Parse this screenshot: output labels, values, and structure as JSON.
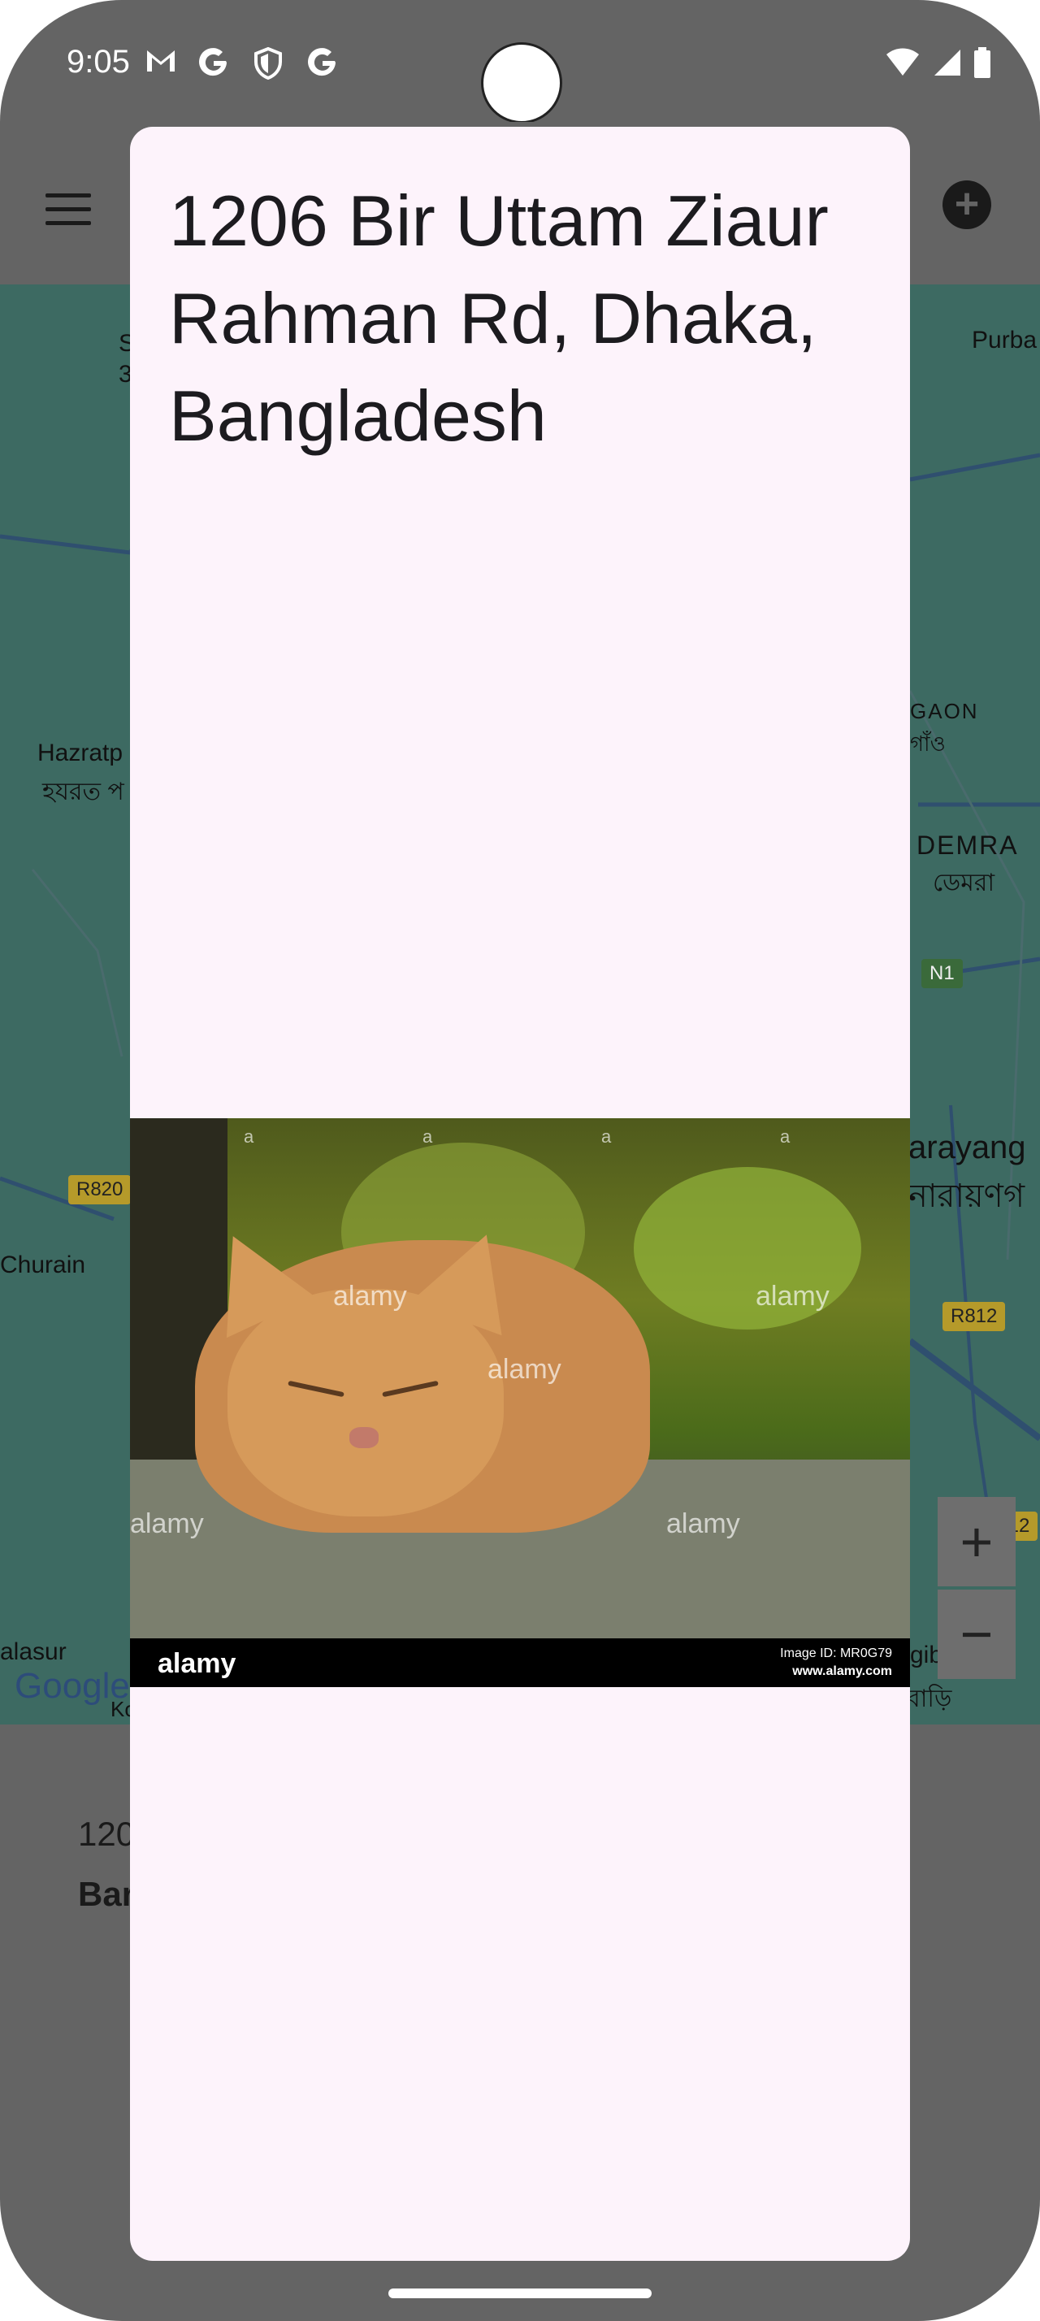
{
  "status_bar": {
    "time": "9:05",
    "left_icons": [
      "gmail-icon",
      "google-icon",
      "shield-icon",
      "google-icon"
    ],
    "right_icons": [
      "wifi-icon",
      "signal-icon",
      "battery-icon"
    ]
  },
  "app_bar": {
    "menu_icon": "menu-icon",
    "action_icon": "add-circle-icon"
  },
  "map": {
    "labels": {
      "purba": "Purba",
      "hazrat_en": "Hazratp",
      "hazrat_bn": "হযরত প",
      "gaon_en": "GAON",
      "gaon_bn": "গাঁও",
      "demra_en": "DEMRA",
      "demra_bn": "ডেমরা",
      "narayang_en": "arayang",
      "narayang_bn": "নারায়ণগ",
      "churain": "Churain",
      "alasur": "alasur",
      "gibari": "gibari",
      "bari_bn": "বাড়ি",
      "edge_s": "S",
      "edge_3": "3",
      "ko": "Ko"
    },
    "road_shields": [
      "R820",
      "N1",
      "R812",
      "R812"
    ],
    "zoom_in": "+",
    "zoom_out": "−",
    "attribution": "Google"
  },
  "background_text": {
    "line1": "120",
    "line2": "Bar"
  },
  "dialog": {
    "title": "1206 Bir Uttam Ziaur Rahman Rd, Dhaka, Bangladesh",
    "image": {
      "footer_logo": "alamy",
      "footer_id": "Image ID: MR0G79",
      "footer_url": "www.alamy.com",
      "watermark_text": "alamy",
      "watermark_small": "a"
    }
  },
  "colors": {
    "scrim": "#646464",
    "dialog_bg": "#fdf3fb",
    "title_text": "#1c1b1f"
  }
}
